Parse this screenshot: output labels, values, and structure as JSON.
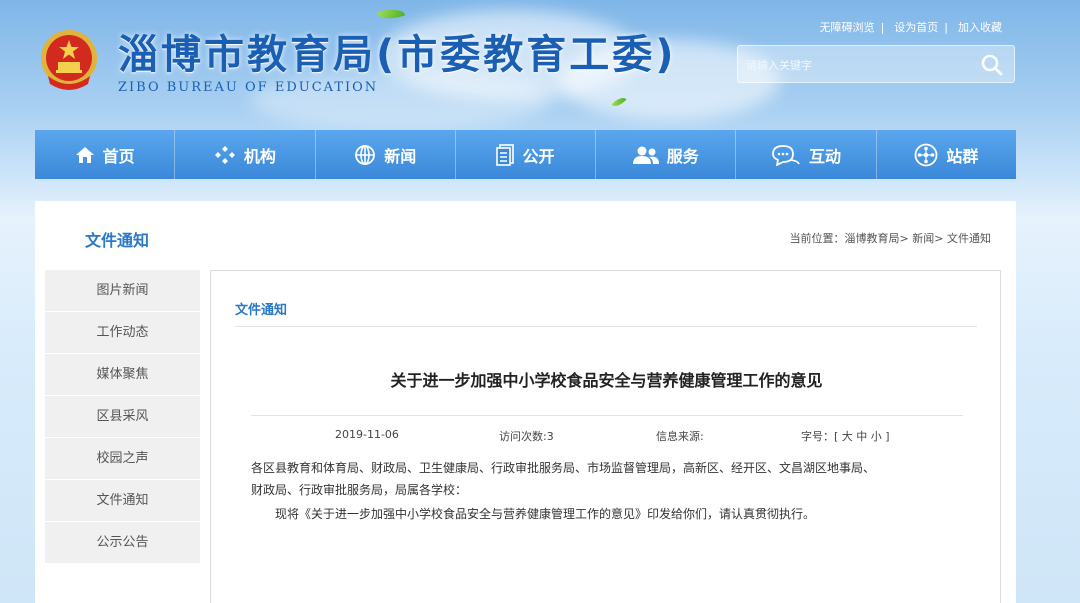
{
  "header": {
    "title": "淄博市教育局(市委教育工委)",
    "subtitle": "ZIBO BUREAU OF EDUCATION",
    "top_links": [
      "无障碍浏览",
      "设为首页",
      "加入收藏"
    ],
    "search_placeholder": "请输入关键字"
  },
  "nav": {
    "items": [
      {
        "label": "首页",
        "icon": "home-icon"
      },
      {
        "label": "机构",
        "icon": "org-icon"
      },
      {
        "label": "新闻",
        "icon": "globe-icon"
      },
      {
        "label": "公开",
        "icon": "document-icon"
      },
      {
        "label": "服务",
        "icon": "users-icon"
      },
      {
        "label": "互动",
        "icon": "chat-icon"
      },
      {
        "label": "站群",
        "icon": "network-icon"
      }
    ]
  },
  "section": {
    "title": "文件通知",
    "breadcrumb": "当前位置：淄博教育局> 新闻> 文件通知"
  },
  "sidebar": {
    "items": [
      "图片新闻",
      "工作动态",
      "媒体聚焦",
      "区县采风",
      "校园之声",
      "文件通知",
      "公示公告"
    ]
  },
  "article": {
    "category": "文件通知",
    "title": "关于进一步加强中小学校食品安全与营养健康管理工作的意见",
    "date": "2019-11-06",
    "views": "访问次数:3",
    "source": "信息来源:",
    "font_size": "字号：[ 大 中 小 ]",
    "body": [
      "各区县教育和体育局、财政局、卫生健康局、行政审批服务局、市场监督管理局，高新区、经开区、文昌湖区地事局、",
      "财政局、行政审批服务局，局属各学校：",
      "　　现将《关于进一步加强中小学校食品安全与营养健康管理工作的意见》印发给你们，请认真贯彻执行。"
    ]
  },
  "colors": {
    "nav_bg": "#3a88d8",
    "accent": "#2a78c8",
    "title_blue": "#1a5fb4"
  }
}
